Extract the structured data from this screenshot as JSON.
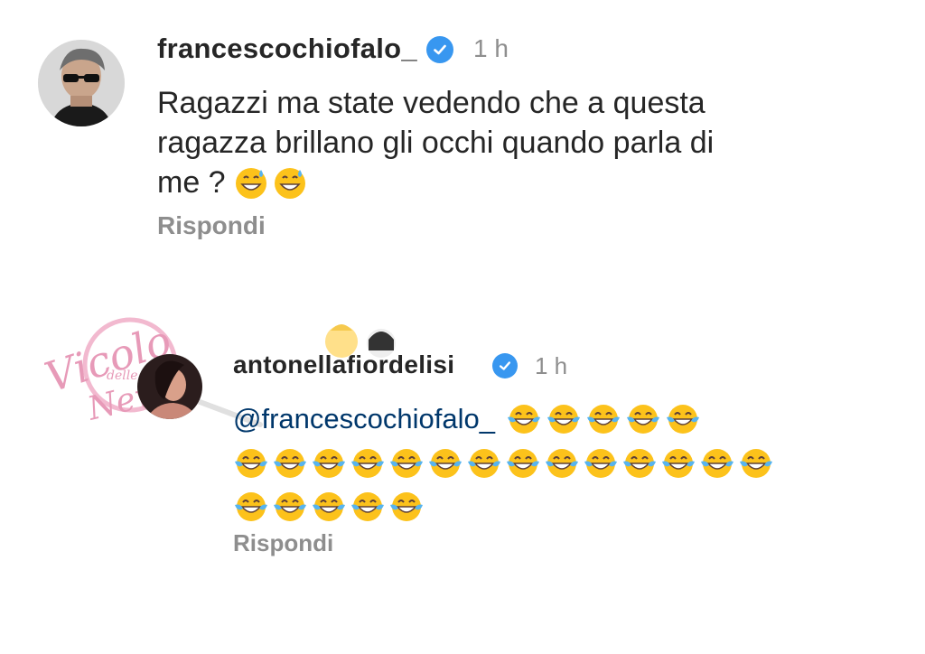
{
  "comments": [
    {
      "username": "francescochiofalo_",
      "time": "1 h",
      "verified": true,
      "text_lines": [
        "Ragazzi ma state vedendo che a questa",
        "ragazza brillano gli occhi quando parla di",
        "me ?"
      ],
      "emojis": [
        "grinning-sweat-emoji",
        "grinning-sweat-emoji"
      ],
      "reply_label": "Rispondi"
    },
    {
      "username": "antonellafiordelisi",
      "time": "1 h",
      "verified": true,
      "mention": "@francescochiofalo_",
      "emoji_rows": [
        5,
        14,
        5
      ],
      "emoji_name": "tears-of-joy-emoji",
      "reply_label": "Rispondi"
    }
  ],
  "watermark": {
    "text_main": "Vicolo",
    "text_small": "delle",
    "text_end": "News"
  },
  "colors": {
    "verified": "#3897f0",
    "text": "#262626",
    "muted": "#8e8e8e",
    "mention": "#00376b",
    "watermark": "#e79ab8"
  }
}
